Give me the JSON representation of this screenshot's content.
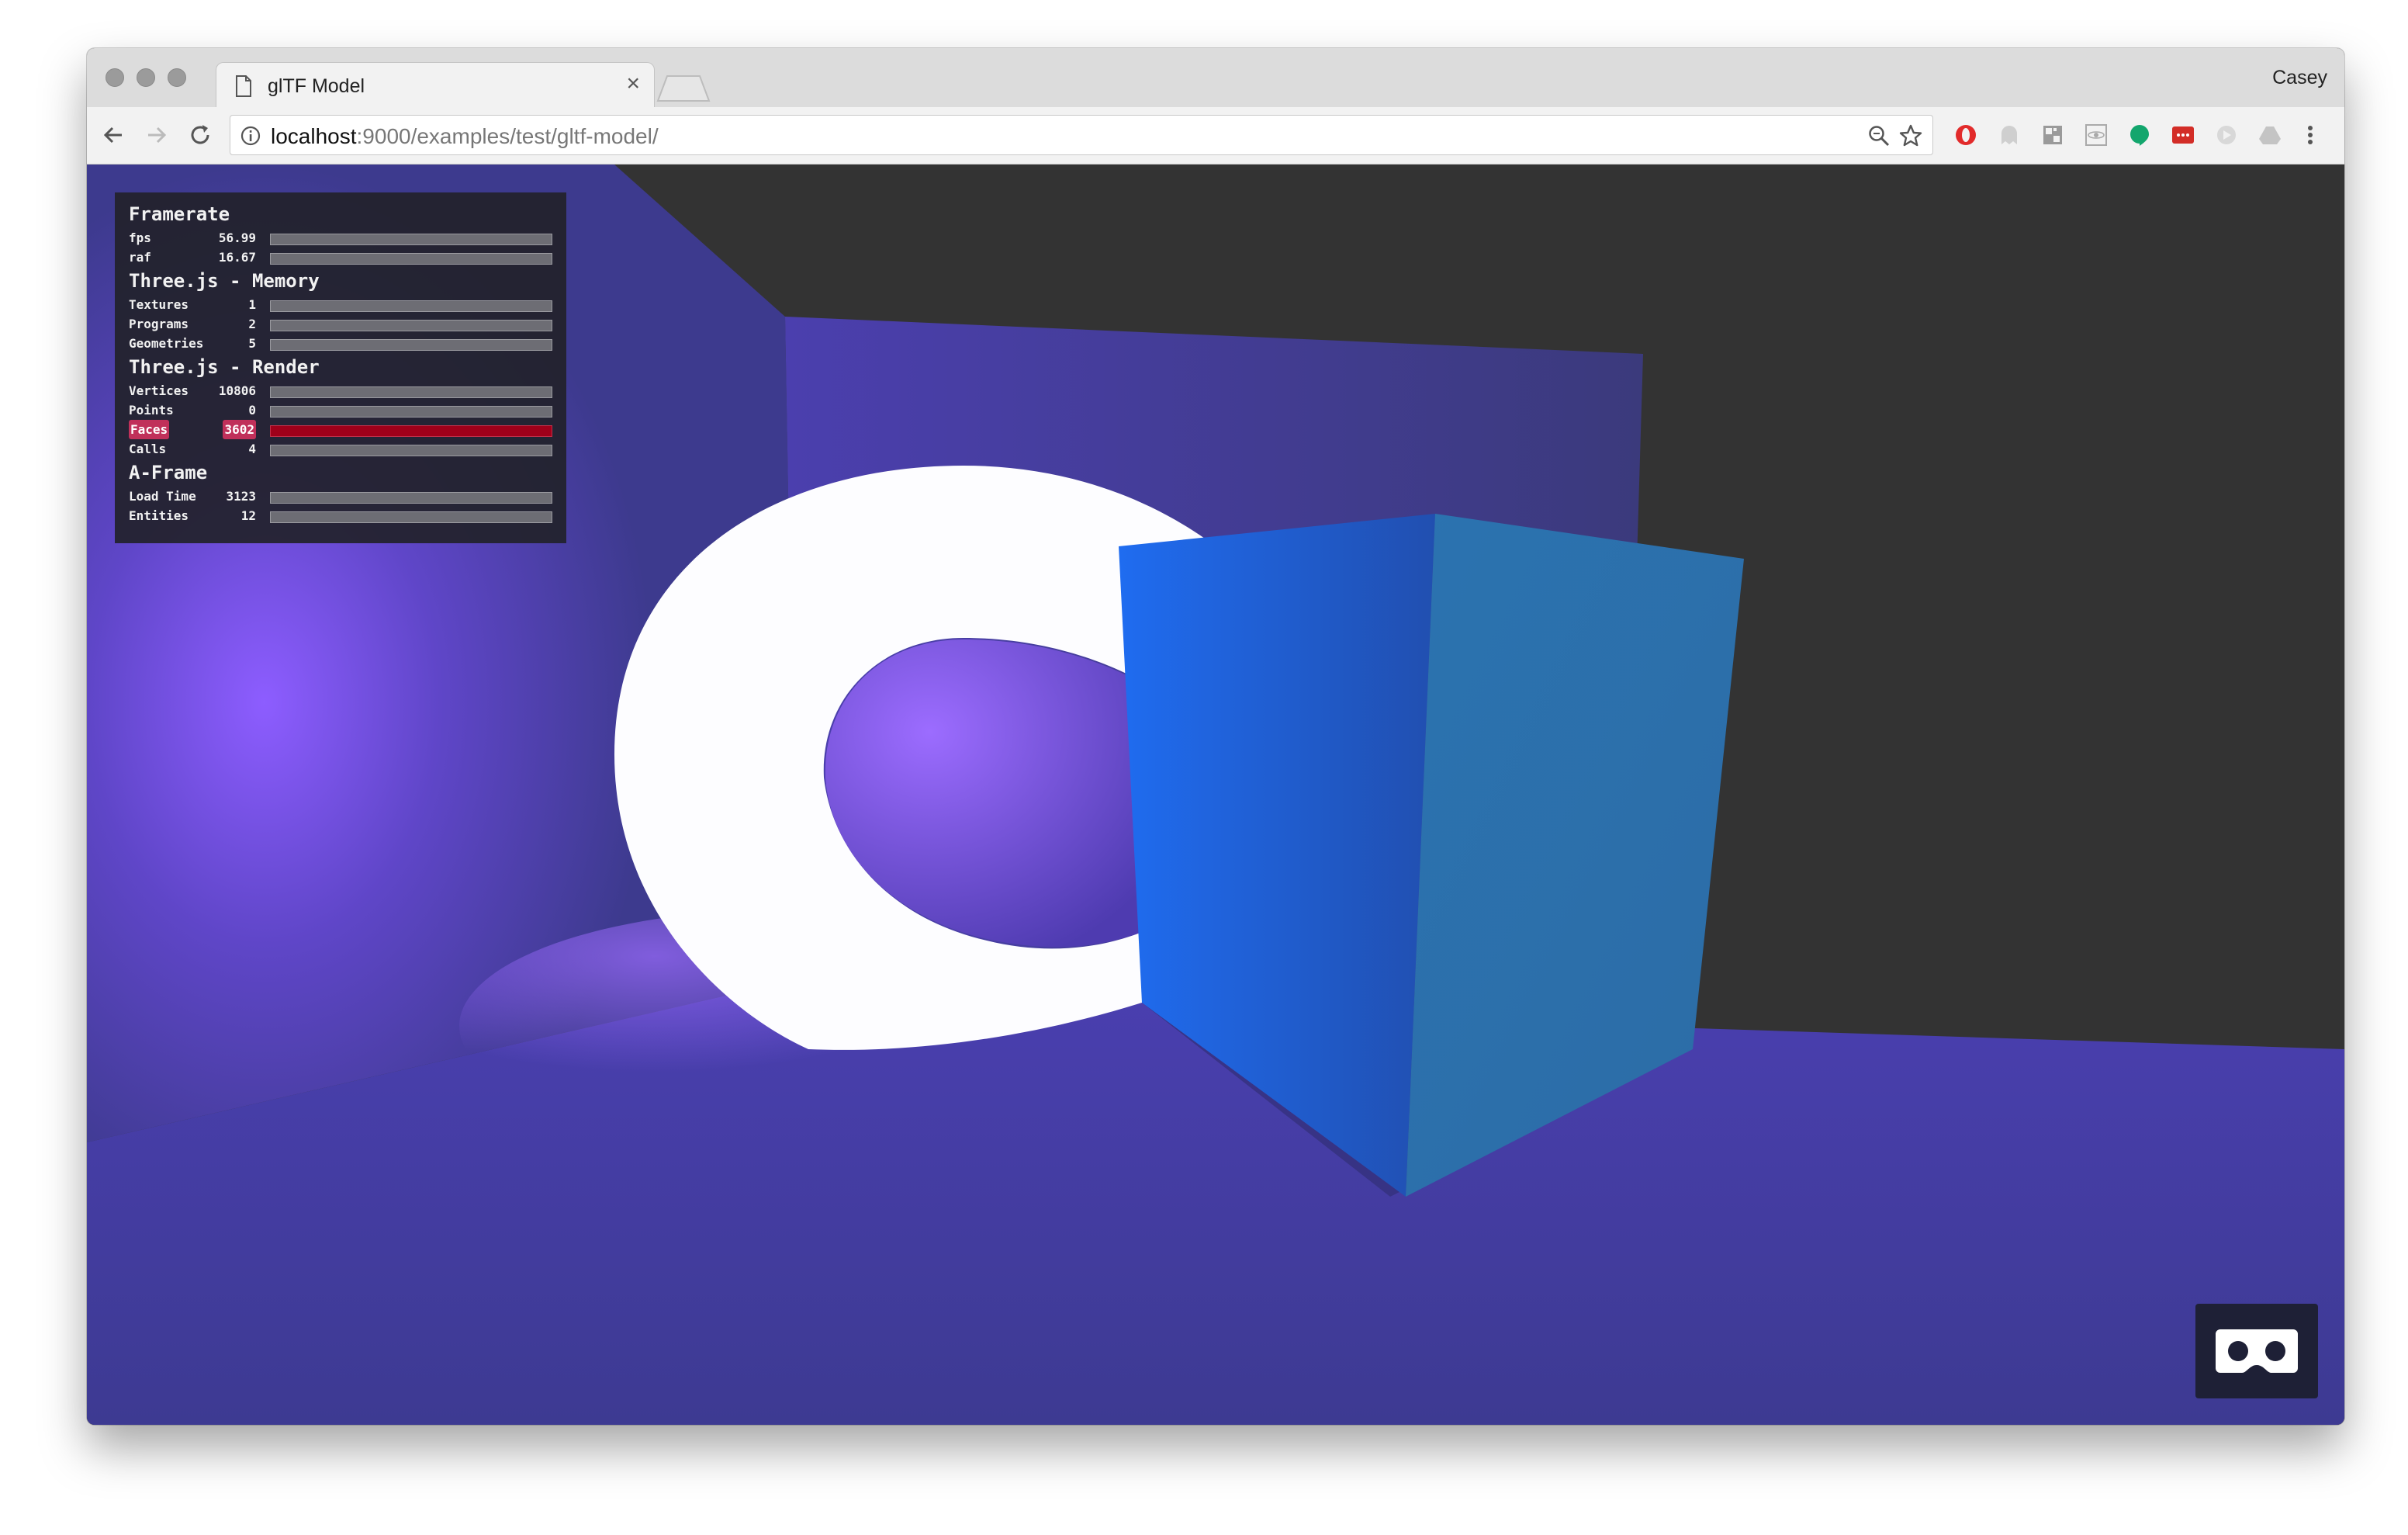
{
  "browser": {
    "tab_title": "glTF Model",
    "tab_close": "×",
    "profile_name": "Casey",
    "url_host": "localhost",
    "url_path": ":9000/examples/test/gltf-model/"
  },
  "stats": {
    "framerate": {
      "heading": "Framerate",
      "rows": [
        {
          "label": "fps",
          "value": "56.99"
        },
        {
          "label": "raf",
          "value": "16.67"
        }
      ]
    },
    "memory": {
      "heading": "Three.js - Memory",
      "rows": [
        {
          "label": "Textures",
          "value": "1"
        },
        {
          "label": "Programs",
          "value": "2"
        },
        {
          "label": "Geometries",
          "value": "5"
        }
      ]
    },
    "render": {
      "heading": "Three.js - Render",
      "rows": [
        {
          "label": "Vertices",
          "value": "10806"
        },
        {
          "label": "Points",
          "value": "0"
        },
        {
          "label": "Faces",
          "value": "3602"
        },
        {
          "label": "Calls",
          "value": "4"
        }
      ]
    },
    "aframe": {
      "heading": "A-Frame",
      "rows": [
        {
          "label": "Load Time",
          "value": "3123"
        },
        {
          "label": "Entities",
          "value": "12"
        }
      ]
    }
  },
  "colors": {
    "scene_background": "#333333",
    "stats_alarm": "#a0001a",
    "vr_button": "#1e2036"
  },
  "icons": {
    "vr": "vr-goggles-icon",
    "tab": "document-icon"
  }
}
